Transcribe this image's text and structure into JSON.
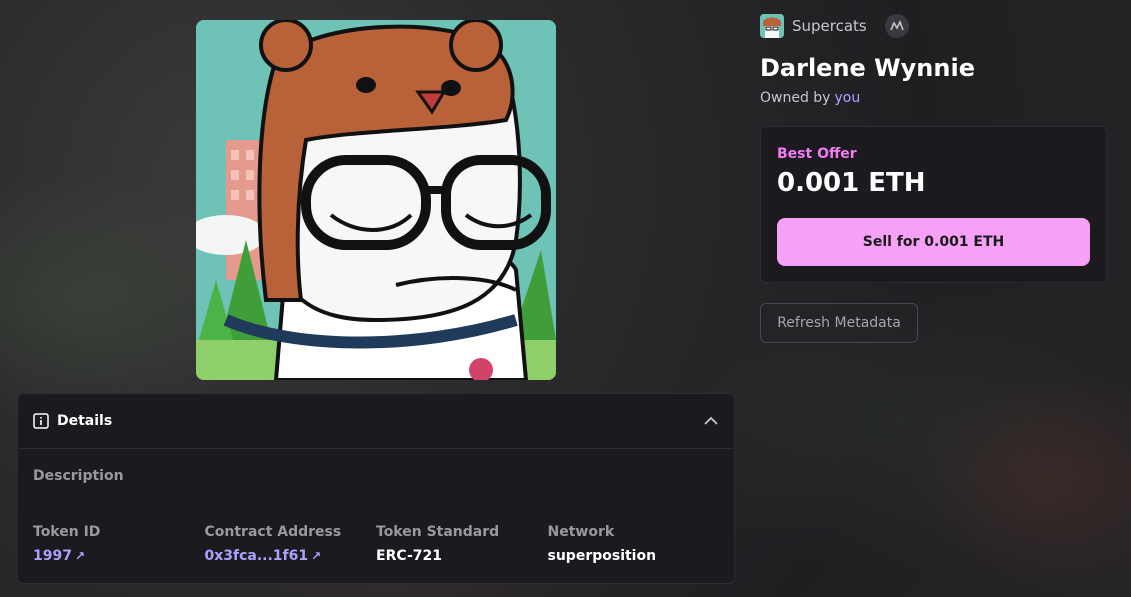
{
  "collection": {
    "name": "Supercats",
    "avatar_icon": "supercat-avatar",
    "marketplace_icon": "marketplace-icon"
  },
  "nft": {
    "name": "Darlene Wynnie",
    "owned_by_label": "Owned by",
    "owner": "you",
    "image_alt": "Supercat NFT artwork"
  },
  "offer": {
    "label": "Best Offer",
    "price": "0.001 ETH",
    "sell_button": "Sell for 0.001 ETH"
  },
  "refresh_button": "Refresh Metadata",
  "details": {
    "title": "Details",
    "description_label": "Description",
    "properties": [
      {
        "label": "Token ID",
        "value": "1997",
        "link": true
      },
      {
        "label": "Contract Address",
        "value": "0x3fca...1f61",
        "link": true
      },
      {
        "label": "Token Standard",
        "value": "ERC-721",
        "link": false
      },
      {
        "label": "Network",
        "value": "superposition",
        "link": false
      }
    ]
  },
  "colors": {
    "accent_pink": "#f27cf4",
    "button_pink": "#f6a0f7",
    "link_purple": "#a9a3ff",
    "card_bg": "#1c1a1f"
  }
}
